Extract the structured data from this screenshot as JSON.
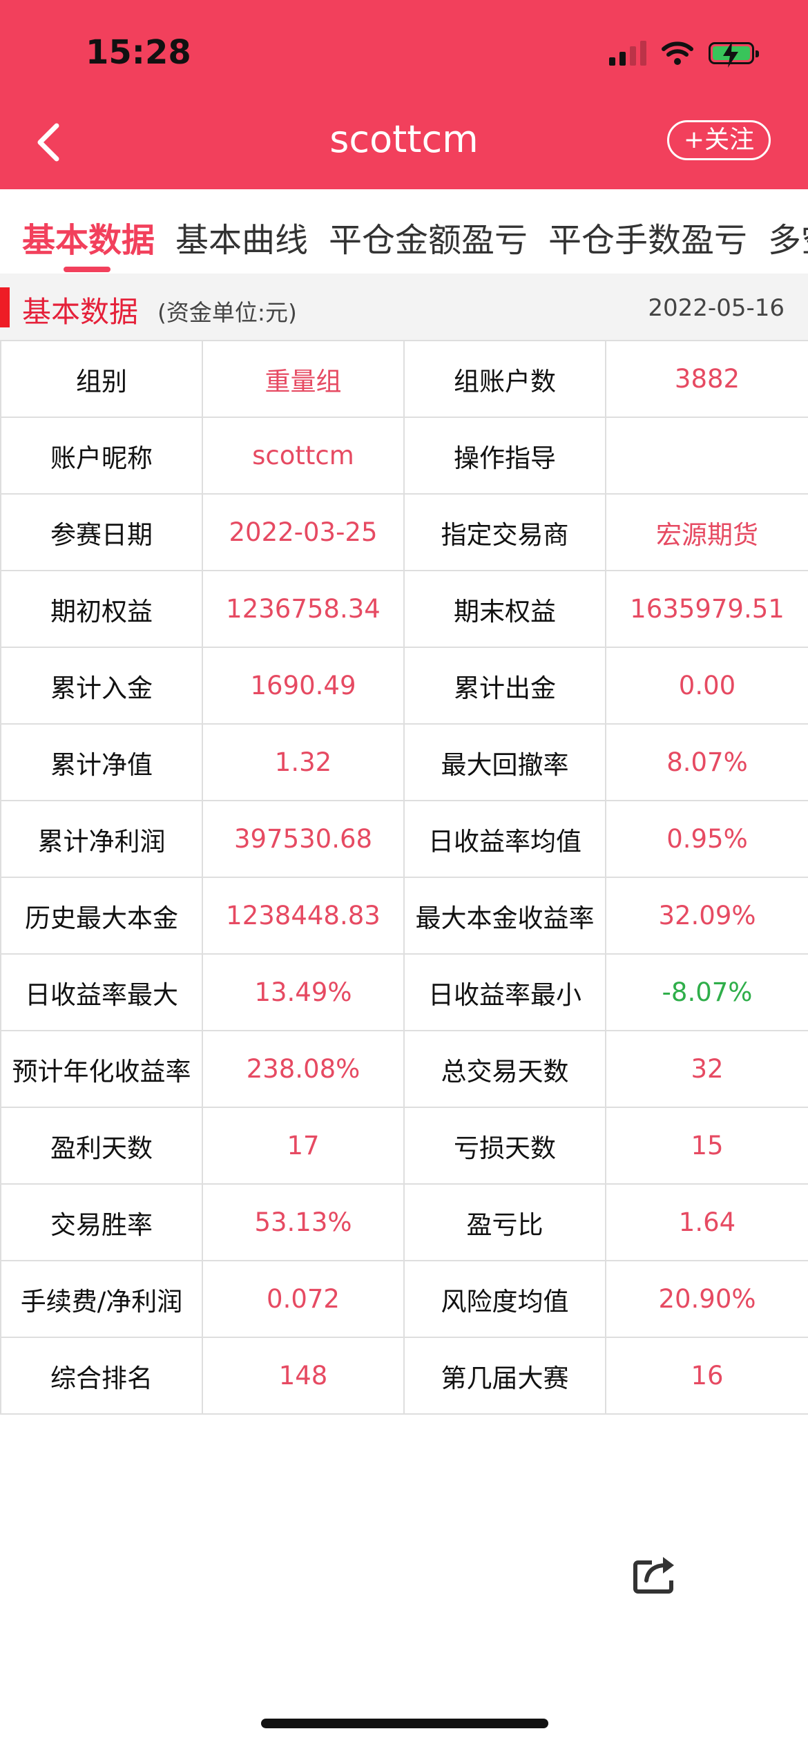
{
  "status_bar": {
    "time": "15:28"
  },
  "header": {
    "title": "scottcm",
    "follow_label": "+关注"
  },
  "tabs": [
    {
      "label": "基本数据",
      "active": true
    },
    {
      "label": "基本曲线"
    },
    {
      "label": "平仓金额盈亏"
    },
    {
      "label": "平仓手数盈亏"
    },
    {
      "label": "多空"
    }
  ],
  "section": {
    "title": "基本数据",
    "unit": "(资金单位:元)",
    "date": "2022-05-16"
  },
  "colors": {
    "header_bg": "#f2405c",
    "value_text": "#e64a62",
    "negative_text": "#2fae4a",
    "section_mark": "#ee1c25"
  },
  "rows": [
    {
      "l1": "组别",
      "v1": "重量组",
      "l2": "组账户数",
      "v2": "3882"
    },
    {
      "l1": "账户昵称",
      "v1": "scottcm",
      "l2": "操作指导",
      "v2": ""
    },
    {
      "l1": "参赛日期",
      "v1": "2022-03-25",
      "l2": "指定交易商",
      "v2": "宏源期货"
    },
    {
      "l1": "期初权益",
      "v1": "1236758.34",
      "l2": "期末权益",
      "v2": "1635979.51"
    },
    {
      "l1": "累计入金",
      "v1": "1690.49",
      "l2": "累计出金",
      "v2": "0.00"
    },
    {
      "l1": "累计净值",
      "v1": "1.32",
      "l2": "最大回撤率",
      "v2": "8.07%"
    },
    {
      "l1": "累计净利润",
      "v1": "397530.68",
      "l2": "日收益率均值",
      "v2": "0.95%"
    },
    {
      "l1": "历史最大本金",
      "v1": "1238448.83",
      "l2": "最大本金收益率",
      "v2": "32.09%"
    },
    {
      "l1": "日收益率最大",
      "v1": "13.49%",
      "l2": "日收益率最小",
      "v2": "-8.07%"
    },
    {
      "l1": "预计年化收益率",
      "v1": "238.08%",
      "l2": "总交易天数",
      "v2": "32"
    },
    {
      "l1": "盈利天数",
      "v1": "17",
      "l2": "亏损天数",
      "v2": "15"
    },
    {
      "l1": "交易胜率",
      "v1": "53.13%",
      "l2": "盈亏比",
      "v2": "1.64"
    },
    {
      "l1": "手续费/净利润",
      "v1": "0.072",
      "l2": "风险度均值",
      "v2": "20.90%"
    },
    {
      "l1": "综合排名",
      "v1": "148",
      "l2": "第几届大赛",
      "v2": "16"
    }
  ],
  "icons": {
    "back": "chevron-left-icon",
    "share": "share-icon",
    "signal": "cellular-signal-icon",
    "wifi": "wifi-icon",
    "battery": "battery-charging-icon"
  }
}
